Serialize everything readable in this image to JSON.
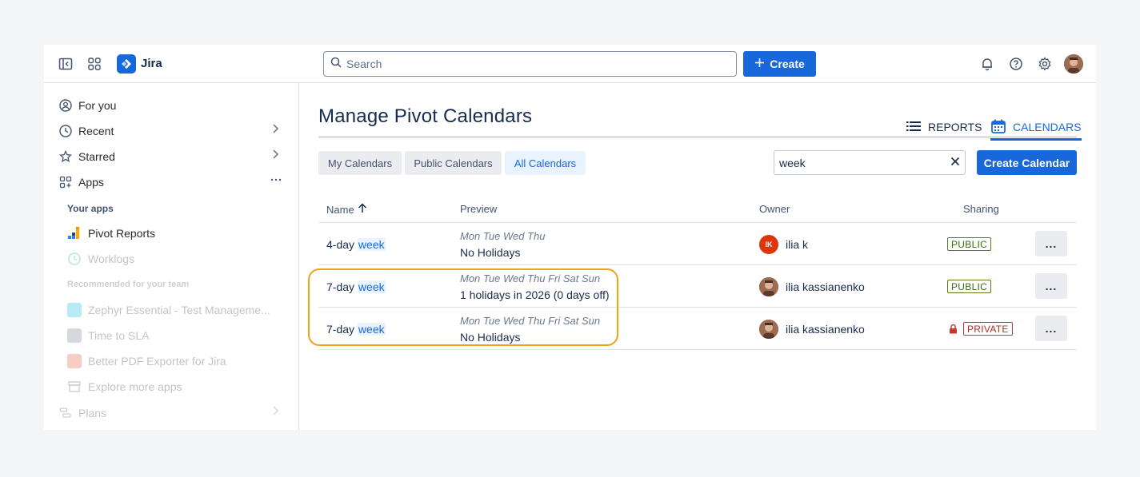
{
  "app": {
    "name": "Jira"
  },
  "topbar": {
    "search_placeholder": "Search",
    "create_label": "Create"
  },
  "sidebar": {
    "items": [
      {
        "label": "For you"
      },
      {
        "label": "Recent"
      },
      {
        "label": "Starred"
      },
      {
        "label": "Apps"
      }
    ],
    "your_apps_heading": "Your apps",
    "your_apps": [
      {
        "label": "Pivot Reports"
      },
      {
        "label": "Worklogs"
      }
    ],
    "recommended_heading": "Recommended for your team",
    "recommended": [
      {
        "label": "Zephyr Essential - Test Manageme..."
      },
      {
        "label": "Time to SLA"
      },
      {
        "label": "Better PDF Exporter for Jira"
      },
      {
        "label": "Explore more apps"
      }
    ],
    "plans_label": "Plans"
  },
  "page": {
    "title": "Manage Pivot Calendars",
    "tabs": [
      {
        "label": "REPORTS",
        "active": false
      },
      {
        "label": "CALENDARS",
        "active": true
      }
    ],
    "filters": [
      {
        "label": "My Calendars",
        "active": false
      },
      {
        "label": "Public Calendars",
        "active": false
      },
      {
        "label": "All Calendars",
        "active": true
      }
    ],
    "search_value": "week",
    "create_calendar_label": "Create Calendar"
  },
  "table": {
    "columns": [
      "Name",
      "Preview",
      "Owner",
      "Sharing"
    ],
    "rows": [
      {
        "name_prefix": "4-day ",
        "name_match": "week",
        "days": "Mon Tue Wed Thu",
        "holidays": "No Holidays",
        "owner": "ilia k",
        "owner_initials": "IK",
        "sharing": "PUBLIC",
        "more": "..."
      },
      {
        "name_prefix": "7-day ",
        "name_match": "week",
        "days": "Mon Tue Wed Thu Fri Sat Sun",
        "holidays": "1 holidays in 2026 (0 days off)",
        "owner": "ilia kassianenko",
        "sharing": "PUBLIC",
        "more": "..."
      },
      {
        "name_prefix": "7-day ",
        "name_match": "week",
        "days": "Mon Tue Wed Thu Fri Sat Sun",
        "holidays": "No Holidays",
        "owner": "ilia kassianenko",
        "sharing": "PRIVATE",
        "more": "..."
      }
    ]
  },
  "colors": {
    "brand": "#1868db",
    "highlight_outline": "#f0a21b",
    "public": "#5a7d12",
    "private": "#c9372c"
  }
}
